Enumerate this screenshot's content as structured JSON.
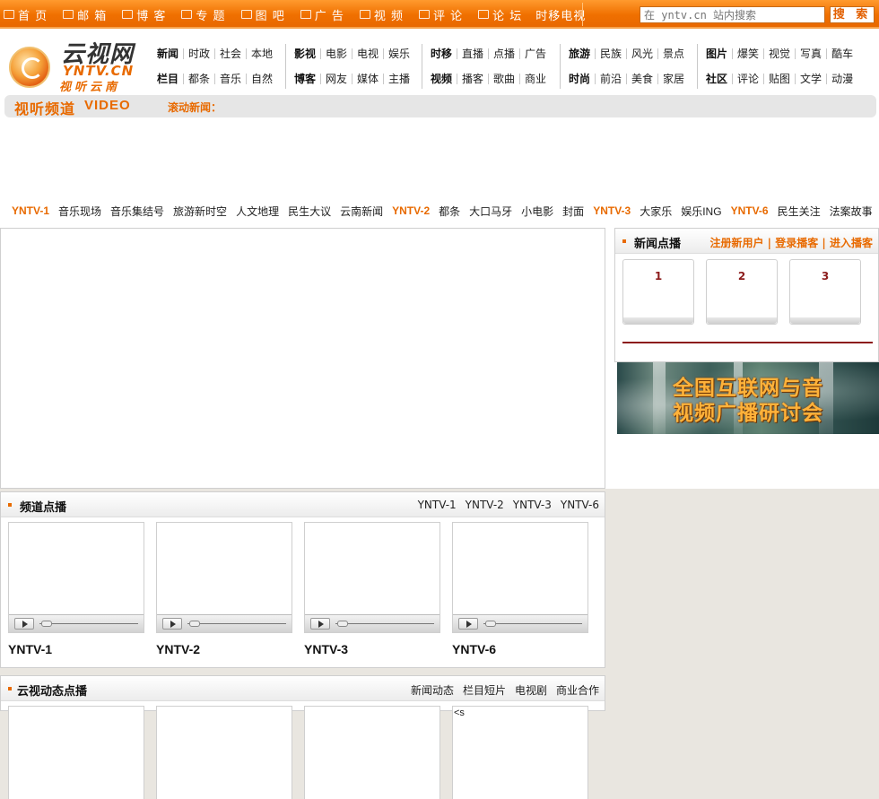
{
  "topnav": {
    "items": [
      {
        "label": "首 页",
        "icon": "home-icon"
      },
      {
        "label": "邮 箱",
        "icon": "mail-icon"
      },
      {
        "label": "博 客",
        "icon": "blog-icon"
      },
      {
        "label": "专 题",
        "icon": "topic-icon"
      },
      {
        "label": "图 吧",
        "icon": "photo-icon"
      },
      {
        "label": "广 告",
        "icon": "ad-icon"
      },
      {
        "label": "视 频",
        "icon": "video-camera-icon"
      },
      {
        "label": "评 论",
        "icon": "comment-icon"
      },
      {
        "label": "论 坛",
        "icon": "forum-icon"
      },
      {
        "label": "时移电视",
        "icon": ""
      }
    ],
    "search_placeholder": "在 yntv.cn 站内搜索",
    "search_button": "搜 索",
    "accent": "#f07000"
  },
  "logo": {
    "cn": "云视网",
    "en": "YNTV.CN",
    "sub": "视听云南"
  },
  "categories": [
    {
      "rows": [
        [
          "新闻",
          "时政",
          "社会",
          "本地"
        ],
        [
          "栏目",
          "都条",
          "音乐",
          "自然"
        ]
      ]
    },
    {
      "rows": [
        [
          "影视",
          "电影",
          "电视",
          "娱乐"
        ],
        [
          "博客",
          "网友",
          "媒体",
          "主播"
        ]
      ]
    },
    {
      "rows": [
        [
          "时移",
          "直播",
          "点播",
          "广告"
        ],
        [
          "视频",
          "播客",
          "歌曲",
          "商业"
        ]
      ]
    },
    {
      "rows": [
        [
          "旅游",
          "民族",
          "风光",
          "景点"
        ],
        [
          "时尚",
          "前沿",
          "美食",
          "家居"
        ]
      ]
    },
    {
      "rows": [
        [
          "图片",
          "爆笑",
          "视觉",
          "写真",
          "酷车"
        ],
        [
          "社区",
          "评论",
          "贴图",
          "文学",
          "动漫"
        ]
      ]
    }
  ],
  "videobar": {
    "title": "视听频道",
    "title_en": "VIDEO",
    "scroll_label": "滚动新闻："
  },
  "program_links": [
    {
      "label": "YNTV-1",
      "channel": true
    },
    {
      "label": "音乐现场",
      "channel": false
    },
    {
      "label": "音乐集结号",
      "channel": false
    },
    {
      "label": "旅游新时空",
      "channel": false
    },
    {
      "label": "人文地理",
      "channel": false
    },
    {
      "label": "民生大议",
      "channel": false
    },
    {
      "label": "云南新闻",
      "channel": false
    },
    {
      "label": "YNTV-2",
      "channel": true
    },
    {
      "label": "都条",
      "channel": false
    },
    {
      "label": "大口马牙",
      "channel": false
    },
    {
      "label": "小电影",
      "channel": false
    },
    {
      "label": "封面",
      "channel": false
    },
    {
      "label": "YNTV-3",
      "channel": true
    },
    {
      "label": "大家乐",
      "channel": false
    },
    {
      "label": "娱乐ING",
      "channel": false
    },
    {
      "label": "YNTV-6",
      "channel": true
    },
    {
      "label": "民生关注",
      "channel": false
    },
    {
      "label": "法案故事",
      "channel": false
    }
  ],
  "news": {
    "title": "新闻点播",
    "links": [
      "注册新用户",
      "登录播客",
      "进入播客"
    ],
    "cards": [
      "1",
      "2",
      "3"
    ]
  },
  "banner": {
    "line1": "全国互联网与音",
    "line2": "视频广播研讨会"
  },
  "channel_section": {
    "title": "频道点播",
    "tabs": [
      "YNTV-1",
      "YNTV-2",
      "YNTV-3",
      "YNTV-6"
    ],
    "cards": [
      "YNTV-1",
      "YNTV-2",
      "YNTV-3",
      "YNTV-6"
    ]
  },
  "dynamic_section": {
    "title": "云视动态点播",
    "tabs": [
      "新闻动态",
      "栏目短片",
      "电视剧",
      "商业合作"
    ]
  },
  "stray_text": "<s"
}
